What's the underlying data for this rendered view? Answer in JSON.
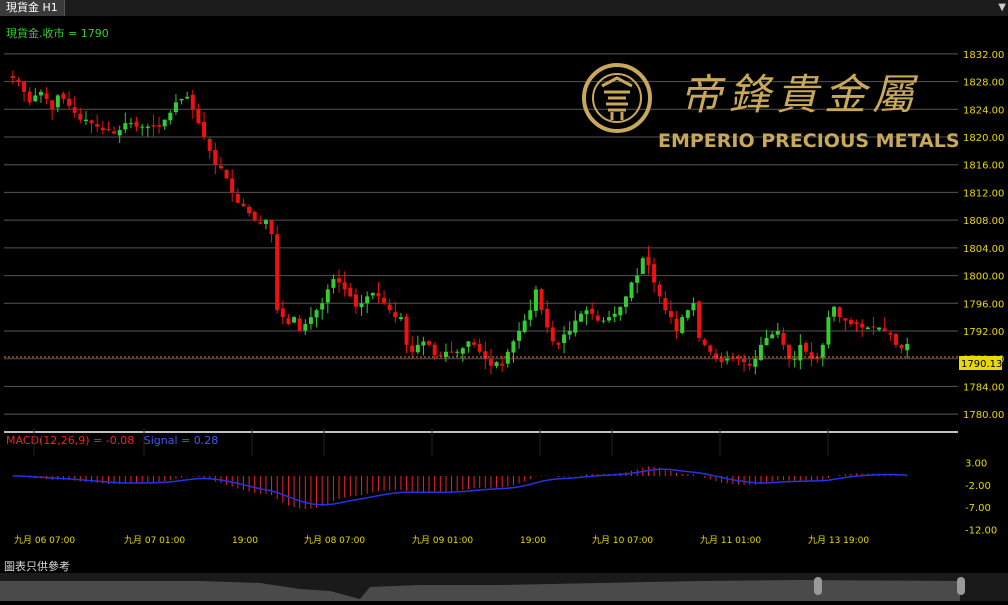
{
  "window": {
    "tab_title": "現貨金 H1",
    "menu_icon": "chevron-down-icon"
  },
  "price_label": "現貨金.收市 = 1790",
  "current_price": "1790.13",
  "watermark": {
    "chinese": "帝鋒貴金屬",
    "english": "EMPERIO PRECIOUS METALS"
  },
  "macd_label": {
    "macd": "MACD(12,26,9) = -0.08",
    "signal": "Signal = 0.28"
  },
  "footer_note": "圖表只供參考",
  "colors": {
    "up": "#33cc33",
    "down": "#ee1111",
    "axis_text": "#e8d900",
    "macd_bar": "#ee2222",
    "signal_line": "#2233ee",
    "price_line": "#ff8800",
    "watermark": "#c9a85a"
  },
  "chart_data": {
    "type": "candlestick",
    "timeframe": "H1",
    "last_close": 1790.13,
    "price_axis": {
      "ylim": [
        1778,
        1834
      ],
      "ticks": [
        "1832.00",
        "1828.00",
        "1824.00",
        "1820.00",
        "1816.00",
        "1812.00",
        "1808.00",
        "1804.00",
        "1800.00",
        "1796.00",
        "1792.00",
        "1788.00",
        "1784.00",
        "1780.00"
      ]
    },
    "time_axis_labels": [
      "九月 06 07:00",
      "九月 07 01:00",
      "19:00",
      "九月 08 07:00",
      "九月 09 01:00",
      "19:00",
      "九月 10 07:00",
      "九月 11 01:00",
      "九月 13 19:00"
    ],
    "close": [
      1828.5,
      1828,
      1826.5,
      1825,
      1826,
      1826.5,
      1825.5,
      1824,
      1826,
      1825.5,
      1824.5,
      1823.5,
      1822.5,
      1822.5,
      1822,
      1821.5,
      1821,
      1821,
      1820.5,
      1821,
      1822,
      1822,
      1821.5,
      1821.5,
      1821.5,
      1821.5,
      1821.5,
      1822.5,
      1823.5,
      1825,
      1825.5,
      1825.8,
      1824,
      1822,
      1820,
      1818,
      1816,
      1815.5,
      1814,
      1812,
      1810.5,
      1810,
      1809,
      1808,
      1807.5,
      1808,
      1806,
      1795,
      1794,
      1793,
      1794,
      1792,
      1793,
      1794,
      1795,
      1796,
      1798,
      1799.5,
      1799,
      1798,
      1797,
      1795.5,
      1796,
      1797,
      1797.5,
      1797,
      1796,
      1795,
      1794,
      1794,
      1790,
      1789,
      1790,
      1790.5,
      1790,
      1788.5,
      1788.5,
      1789,
      1789,
      1789,
      1789.5,
      1790.5,
      1790,
      1789,
      1788,
      1787,
      1787.5,
      1787,
      1789,
      1790.5,
      1792,
      1793.5,
      1795,
      1798,
      1795,
      1792.5,
      1790.5,
      1790,
      1791.5,
      1792,
      1793.5,
      1794.5,
      1795,
      1794.5,
      1793.5,
      1793.5,
      1794,
      1794.5,
      1795.5,
      1797,
      1799,
      1800,
      1802.5,
      1801.5,
      1799,
      1797,
      1795,
      1794,
      1792,
      1794,
      1795,
      1796,
      1791,
      1790,
      1789,
      1788,
      1787.5,
      1788,
      1788,
      1788,
      1787.5,
      1787,
      1788,
      1790,
      1791,
      1791.5,
      1792,
      1790,
      1788,
      1788,
      1790,
      1789,
      1788,
      1788,
      1790,
      1794,
      1795.5,
      1794,
      1793.5,
      1793,
      1793,
      1792.5,
      1792.5,
      1792.5,
      1792.5,
      1792,
      1791.5,
      1790,
      1789.5,
      1790.13
    ],
    "ohlc_stats": {
      "bars": 154
    },
    "macd": {
      "label_macd": "MACD(12,26,9)",
      "value_macd": -0.08,
      "label_signal": "Signal",
      "value_signal": 0.28,
      "ylim": [
        -13.5,
        4.5
      ],
      "ticks": [
        "3.00",
        "-2.00",
        "-7.00",
        "-12.00"
      ]
    }
  }
}
